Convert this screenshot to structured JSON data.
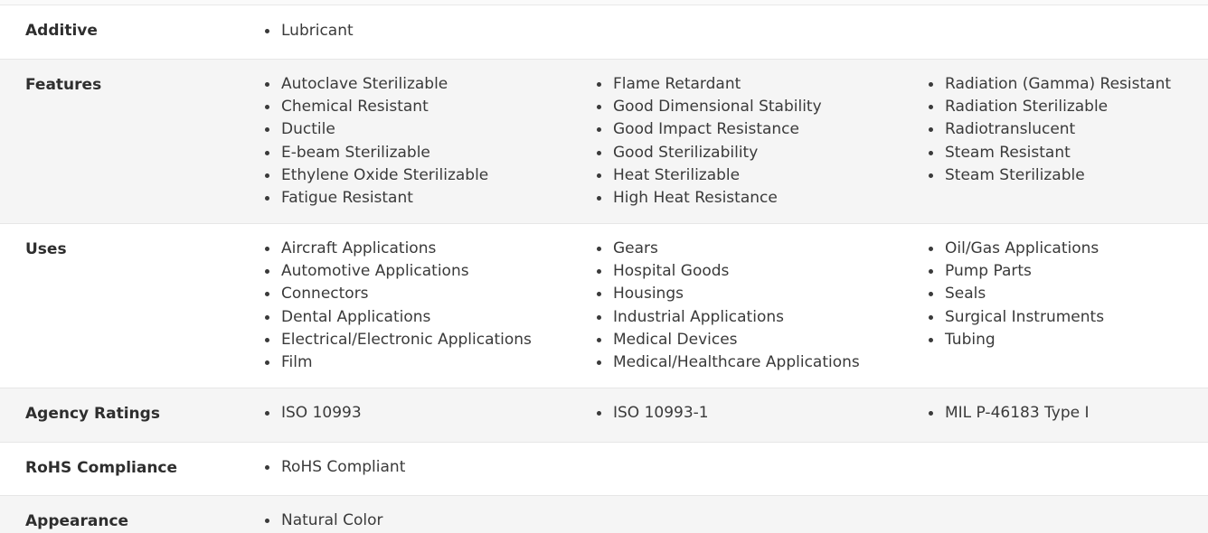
{
  "rows": [
    {
      "label": "Additive",
      "columns": [
        [
          "Lubricant"
        ]
      ]
    },
    {
      "label": "Features",
      "columns": [
        [
          "Autoclave Sterilizable",
          "Chemical Resistant",
          "Ductile",
          "E-beam Sterilizable",
          "Ethylene Oxide Sterilizable",
          "Fatigue Resistant"
        ],
        [
          "Flame Retardant",
          "Good Dimensional Stability",
          "Good Impact Resistance",
          "Good Sterilizability",
          "Heat Sterilizable",
          "High Heat Resistance"
        ],
        [
          "Radiation (Gamma) Resistant",
          "Radiation Sterilizable",
          "Radiotranslucent",
          "Steam Resistant",
          "Steam Sterilizable"
        ]
      ]
    },
    {
      "label": "Uses",
      "columns": [
        [
          "Aircraft Applications",
          "Automotive Applications",
          "Connectors",
          "Dental Applications",
          "Electrical/Electronic Applications",
          "Film"
        ],
        [
          "Gears",
          "Hospital Goods",
          "Housings",
          "Industrial Applications",
          "Medical Devices",
          "Medical/Healthcare Applications"
        ],
        [
          "Oil/Gas Applications",
          "Pump Parts",
          "Seals",
          "Surgical Instruments",
          "Tubing"
        ]
      ]
    },
    {
      "label": "Agency Ratings",
      "columns": [
        [
          "ISO 10993"
        ],
        [
          "ISO 10993-1"
        ],
        [
          "MIL P-46183 Type I"
        ]
      ]
    },
    {
      "label": "RoHS Compliance",
      "columns": [
        [
          "RoHS Compliant"
        ]
      ]
    },
    {
      "label": "Appearance",
      "columns": [
        [
          "Natural Color"
        ]
      ]
    }
  ]
}
